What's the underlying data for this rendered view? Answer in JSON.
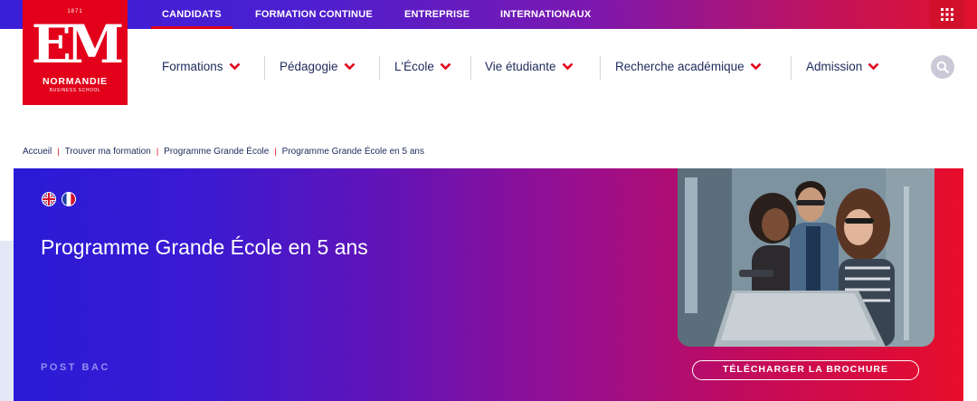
{
  "topbar": {
    "links": [
      {
        "label": "CANDIDATS",
        "active": true
      },
      {
        "label": "FORMATION CONTINUE",
        "active": false
      },
      {
        "label": "ENTREPRISE",
        "active": false
      },
      {
        "label": "INTERNATIONAUX",
        "active": false
      }
    ],
    "menu_icon": "grid-icon"
  },
  "logo": {
    "year": "1871",
    "mark": "EM",
    "line1": "NORMANDIE",
    "line2": "BUSINESS SCHOOL"
  },
  "nav": {
    "items": [
      {
        "label": "Formations"
      },
      {
        "label": "Pédagogie"
      },
      {
        "label": "L'École"
      },
      {
        "label": "Vie étudiante"
      },
      {
        "label": "Recherche académique"
      },
      {
        "label": "Admission"
      }
    ],
    "search_icon": "search-icon"
  },
  "breadcrumb": [
    "Accueil",
    "Trouver ma formation",
    "Programme Grande École",
    "Programme Grande École en 5 ans"
  ],
  "hero": {
    "languages": [
      "english-flag-icon",
      "french-flag-icon"
    ],
    "title": "Programme Grande École en 5 ans",
    "tag": "POST BAC",
    "cta": "TÉLÉCHARGER LA BROCHURE"
  },
  "colors": {
    "brand_red": "#e2001a",
    "brand_blue": "#2a1bd6",
    "navy_text": "#1d2a5b"
  }
}
